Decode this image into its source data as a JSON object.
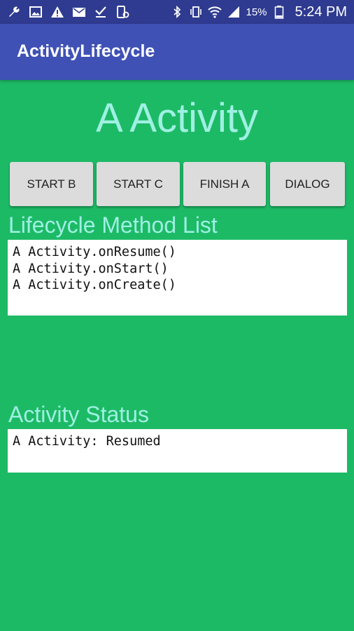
{
  "status_bar": {
    "battery": "15%",
    "time": "5:24 PM",
    "icons_left": [
      "wrench-icon",
      "image-icon",
      "warning-icon",
      "mail-icon",
      "check-download-icon",
      "device-icon"
    ],
    "icons_right": [
      "bluetooth-icon",
      "vibrate-icon",
      "wifi-icon",
      "signal-icon",
      "battery-icon"
    ]
  },
  "app_bar": {
    "title": "ActivityLifecycle"
  },
  "main": {
    "headline": "A Activity",
    "buttons": [
      {
        "label": "START B"
      },
      {
        "label": "START C"
      },
      {
        "label": "FINISH A"
      },
      {
        "label": "DIALOG"
      }
    ],
    "lifecycle_section": {
      "label": "Lifecycle Method List",
      "lines": [
        "A Activity.onResume()",
        "A Activity.onStart()",
        "A Activity.onCreate()"
      ]
    },
    "status_section": {
      "label": "Activity Status",
      "lines": [
        "A Activity: Resumed"
      ]
    }
  },
  "colors": {
    "background": "#1dba66",
    "app_bar": "#3f51b5",
    "status_bar": "#2f3b90",
    "accent_text": "#9ff0e3",
    "button": "#dcdcdc"
  }
}
